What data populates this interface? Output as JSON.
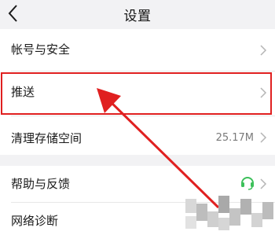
{
  "header": {
    "title": "设置"
  },
  "settings": {
    "account_security": "帐号与安全",
    "push": "推送",
    "clear_storage": "清理存储空间",
    "storage_size": "25.17M",
    "help_feedback": "帮助与反馈",
    "network_diagnosis": "网络诊断"
  },
  "colors": {
    "highlight": "#e02020",
    "headset_icon": "#3cc05a"
  },
  "icons": {
    "back": "chevron-left-icon",
    "row_arrow": "chevron-right-icon",
    "help": "headset-icon"
  }
}
